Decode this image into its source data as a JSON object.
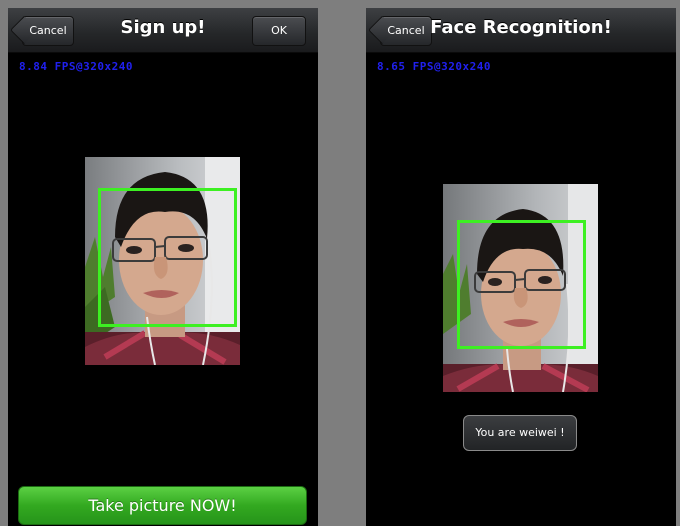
{
  "left_screen": {
    "nav": {
      "back_label": "Cancel",
      "title": "Sign up!",
      "ok_label": "OK"
    },
    "perf_text": "8.84 FPS@320x240",
    "action_button": "Take picture NOW!",
    "face_box_color": "#3df022"
  },
  "right_screen": {
    "nav": {
      "back_label": "Cancel",
      "title": "Face Recognition!"
    },
    "perf_text": "8.65 FPS@320x240",
    "toast": "You are weiwei !",
    "face_box_color": "#3df022"
  },
  "colors": {
    "accent_green": "#33a920",
    "fps_text": "#2020ee"
  }
}
